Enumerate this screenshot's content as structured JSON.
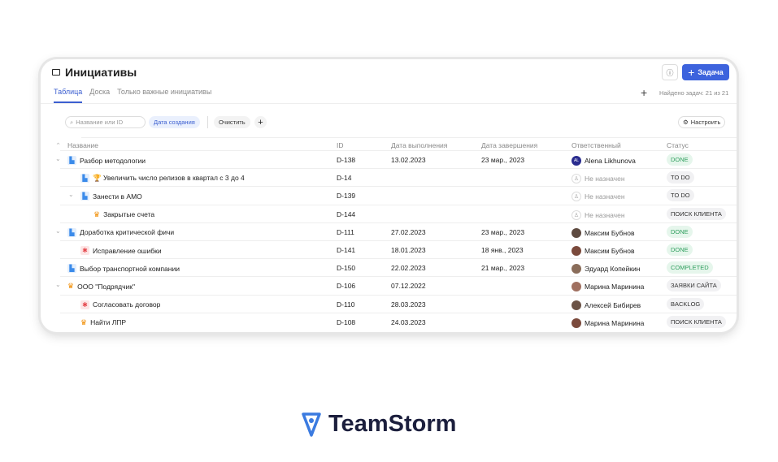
{
  "page": {
    "title": "Инициативы",
    "tabs": [
      "Таблица",
      "Доска",
      "Только важные инициативы"
    ],
    "active_tab": 0,
    "add_task_label": "Задача",
    "found_text": "Найдено задач: 21 из 21",
    "search_placeholder": "Название или ID",
    "filter_chip": "Дата создания",
    "clear_label": "Очистить",
    "configure_label": "Настроить"
  },
  "columns": [
    "Название",
    "ID",
    "Дата выполнения",
    "Дата завершения",
    "Ответственный",
    "Статус"
  ],
  "rows": [
    {
      "name": "Разбор методологии",
      "icon": "doc",
      "level": 0,
      "expand": true,
      "id": "D-138",
      "due": "13.02.2023",
      "end": "23 мар., 2023",
      "owner": "Alena Likhunova",
      "avatar": "AL",
      "status": "DONE",
      "green": true
    },
    {
      "name": "🏆 Увеличить число релизов в квартал с 3 до 4",
      "icon": "doc",
      "level": 1,
      "expand": false,
      "id": "D-14",
      "due": "",
      "end": "",
      "owner": "Не назначен",
      "avatar": "",
      "status": "TO DO",
      "green": false
    },
    {
      "name": "Занести в АМО",
      "icon": "doc",
      "level": 1,
      "expand": true,
      "id": "D-139",
      "due": "",
      "end": "",
      "owner": "Не назначен",
      "avatar": "",
      "status": "TO DO",
      "green": false
    },
    {
      "name": "Закрытые счета",
      "icon": "crown",
      "level": 2,
      "expand": false,
      "id": "D-144",
      "due": "",
      "end": "",
      "owner": "Не назначен",
      "avatar": "",
      "status": "ПОИСК КЛИЕНТА",
      "green": false
    },
    {
      "name": "Доработка критической фичи",
      "icon": "doc",
      "level": 0,
      "expand": true,
      "id": "D-111",
      "due": "27.02.2023",
      "end": "23 мар., 2023",
      "owner": "Максим Бубнов",
      "avatar": "photo",
      "status": "DONE",
      "green": true
    },
    {
      "name": "Исправление ошибки",
      "icon": "bug",
      "level": 1,
      "expand": false,
      "id": "D-141",
      "due": "18.01.2023",
      "end": "18 янв., 2023",
      "owner": "Максим Бубнов",
      "avatar": "photo",
      "status": "DONE",
      "green": true
    },
    {
      "name": "Выбор транспортной компании",
      "icon": "doc",
      "level": 0,
      "expand": false,
      "id": "D-150",
      "due": "22.02.2023",
      "end": "21 мар., 2023",
      "owner": "Эдуард Копейкин",
      "avatar": "photo",
      "status": "COMPLETED",
      "green": true
    },
    {
      "name": "ООО \"Подрядчик\"",
      "icon": "crown",
      "level": 0,
      "expand": true,
      "id": "D-106",
      "due": "07.12.2022",
      "end": "",
      "owner": "Марина Маринина",
      "avatar": "photo",
      "status": "ЗАЯВКИ САЙТА",
      "green": false
    },
    {
      "name": "Согласовать договор",
      "icon": "bug",
      "level": 1,
      "expand": false,
      "id": "D-110",
      "due": "28.03.2023",
      "end": "",
      "owner": "Алексей Бибирев",
      "avatar": "photo",
      "status": "BACKLOG",
      "green": false
    },
    {
      "name": "Найти ЛПР",
      "icon": "crown",
      "level": 1,
      "expand": false,
      "id": "D-108",
      "due": "24.03.2023",
      "end": "",
      "owner": "Марина Маринина",
      "avatar": "photo",
      "status": "ПОИСК КЛИЕНТА",
      "green": false
    }
  ],
  "brand": {
    "name": "TeamStorm",
    "accent": "#3d63dd",
    "logo_color": "#3b7be0"
  }
}
